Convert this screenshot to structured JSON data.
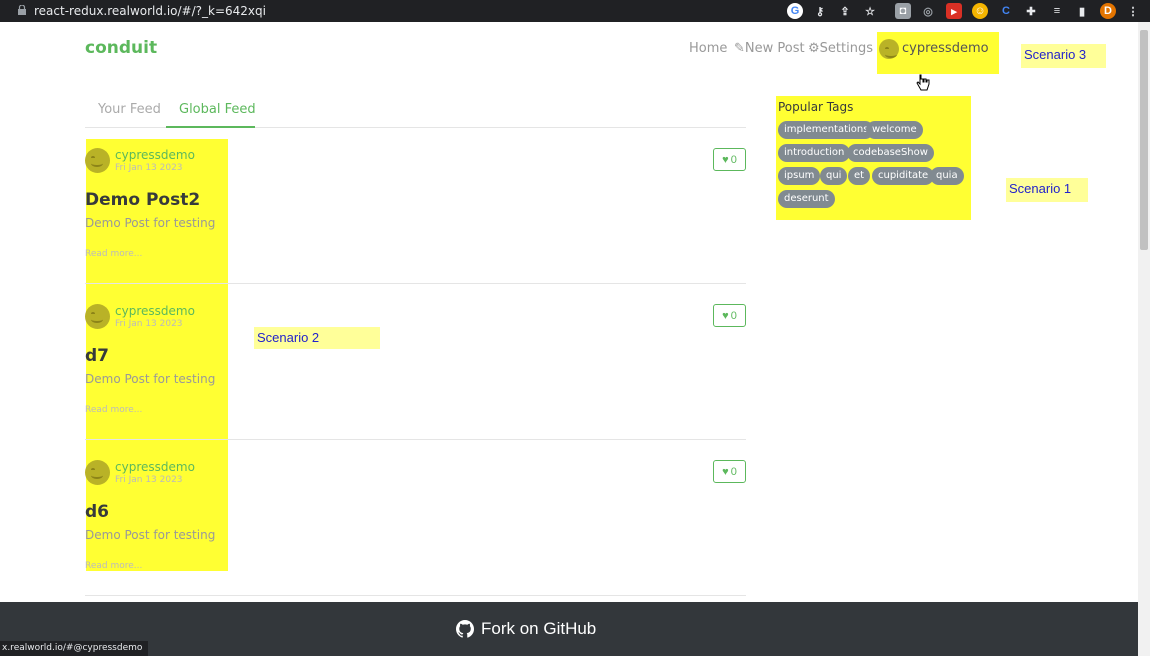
{
  "browser": {
    "url": "react-redux.realworld.io/#/?_k=642xqi",
    "status_url": "x.realworld.io/#@cypressdemo"
  },
  "navbar": {
    "brand": "conduit",
    "home": "Home",
    "new_post": "New Post",
    "settings": "Settings",
    "user": "cypressdemo"
  },
  "feed_tabs": {
    "your_feed": "Your Feed",
    "global_feed": "Global Feed"
  },
  "articles": [
    {
      "author": "cypressdemo",
      "date": "Fri Jan 13 2023",
      "title": "Demo Post2",
      "description": "Demo Post for testing",
      "read_more": "Read more...",
      "favorites": "0"
    },
    {
      "author": "cypressdemo",
      "date": "Fri Jan 13 2023",
      "title": "d7",
      "description": "Demo Post for testing",
      "read_more": "Read more...",
      "favorites": "0"
    },
    {
      "author": "cypressdemo",
      "date": "Fri Jan 13 2023",
      "title": "d6",
      "description": "Demo Post for testing",
      "read_more": "Read more...",
      "favorites": "0"
    }
  ],
  "sidebar": {
    "header": "Popular Tags",
    "tags": [
      "implementations",
      "welcome",
      "introduction",
      "codebaseShow",
      "ipsum",
      "qui",
      "et",
      "cupiditate",
      "quia",
      "deserunt"
    ]
  },
  "annotations": {
    "scenario1": "Scenario 1",
    "scenario2": "Scenario 2",
    "scenario3": "Scenario 3"
  },
  "footer": {
    "text": "Fork on GitHub"
  },
  "colors": {
    "brand": "#5cb85c",
    "highlight": "#ffff33",
    "tag": "#818a91",
    "footer": "#33373b"
  }
}
